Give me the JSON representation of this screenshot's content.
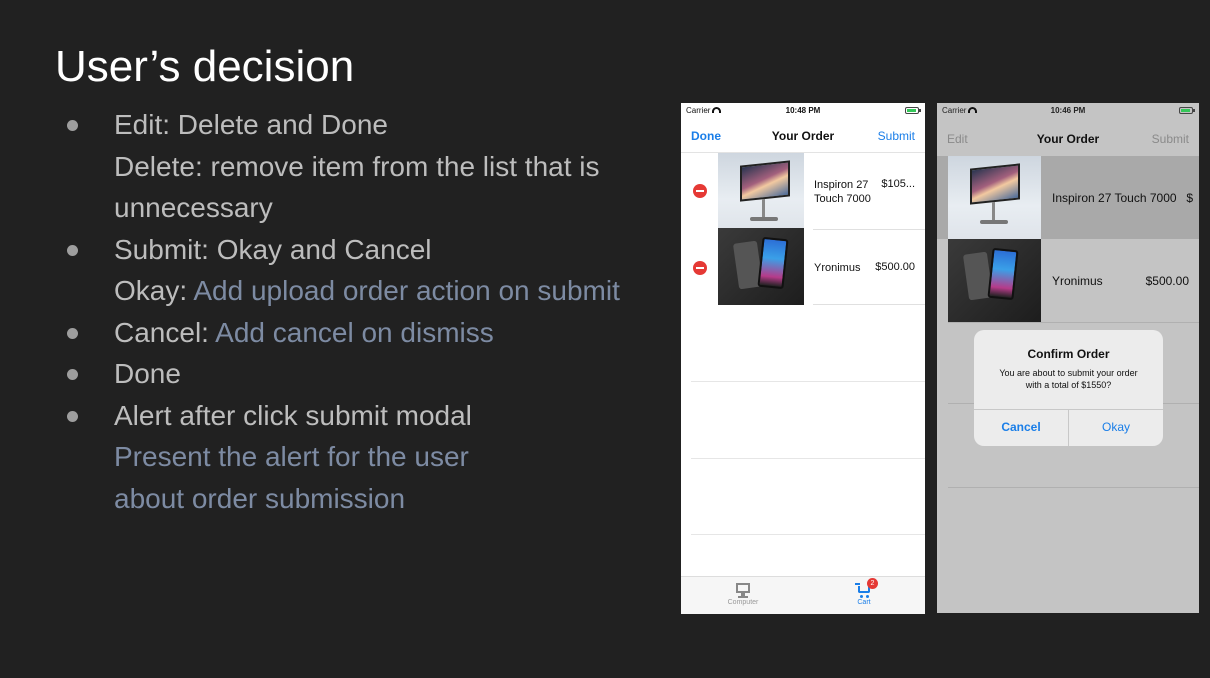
{
  "slide": {
    "title": "User’s decision",
    "bullets": [
      {
        "lines": [
          [
            {
              "text": "Edit: Delete and Done",
              "accent": false
            }
          ],
          [
            {
              "text": "Delete: remove item from the list that is",
              "accent": false
            }
          ],
          [
            {
              "text": "unnecessary",
              "accent": false
            }
          ]
        ]
      },
      {
        "lines": [
          [
            {
              "text": "Submit: Okay and Cancel",
              "accent": false
            }
          ],
          [
            {
              "text": "Okay: ",
              "accent": false
            },
            {
              "text": "Add upload order action on submit",
              "accent": true
            }
          ]
        ]
      },
      {
        "lines": [
          [
            {
              "text": "Cancel: ",
              "accent": false
            },
            {
              "text": "Add cancel on dismiss",
              "accent": true
            }
          ]
        ]
      },
      {
        "lines": [
          [
            {
              "text": "Done",
              "accent": false
            }
          ]
        ]
      },
      {
        "lines": [
          [
            {
              "text": "Alert after click submit modal",
              "accent": false
            }
          ],
          [
            {
              "text": "Present the alert for the user",
              "accent": true
            }
          ],
          [
            {
              "text": "about order submission",
              "accent": true
            }
          ]
        ]
      }
    ]
  },
  "phone1": {
    "status": {
      "carrier": "Carrier",
      "time": "10:48 PM"
    },
    "nav": {
      "left": "Done",
      "title": "Your Order",
      "right": "Submit"
    },
    "items": [
      {
        "name_line1": "Inspiron 27",
        "name_line2": "Touch 7000",
        "price": "$105..."
      },
      {
        "name_line1": "Yronimus",
        "name_line2": "",
        "price": "$500.00"
      }
    ],
    "tabs": {
      "computer": "Computer",
      "cart": "Cart",
      "cart_badge": "2"
    }
  },
  "phone2": {
    "status": {
      "carrier": "Carrier",
      "time": "10:46 PM"
    },
    "nav": {
      "left": "Edit",
      "title": "Your Order",
      "right": "Submit"
    },
    "items": [
      {
        "name": "Inspiron 27 Touch 7000",
        "price": "$"
      },
      {
        "name": "Yronimus",
        "price": "$500.00"
      }
    ],
    "alert": {
      "title": "Confirm Order",
      "message_line1": "You are about to submit your order",
      "message_line2": "with a total of $1550?",
      "cancel": "Cancel",
      "okay": "Okay"
    }
  },
  "colors": {
    "background": "#212121",
    "text": "#bdbdbd",
    "accent_text": "#7d8ba3",
    "ios_blue": "#1a7ee8",
    "delete_red": "#e53935"
  },
  "icons": [
    "wifi-icon",
    "battery-icon",
    "delete-icon",
    "monitor-icon",
    "cart-icon"
  ]
}
